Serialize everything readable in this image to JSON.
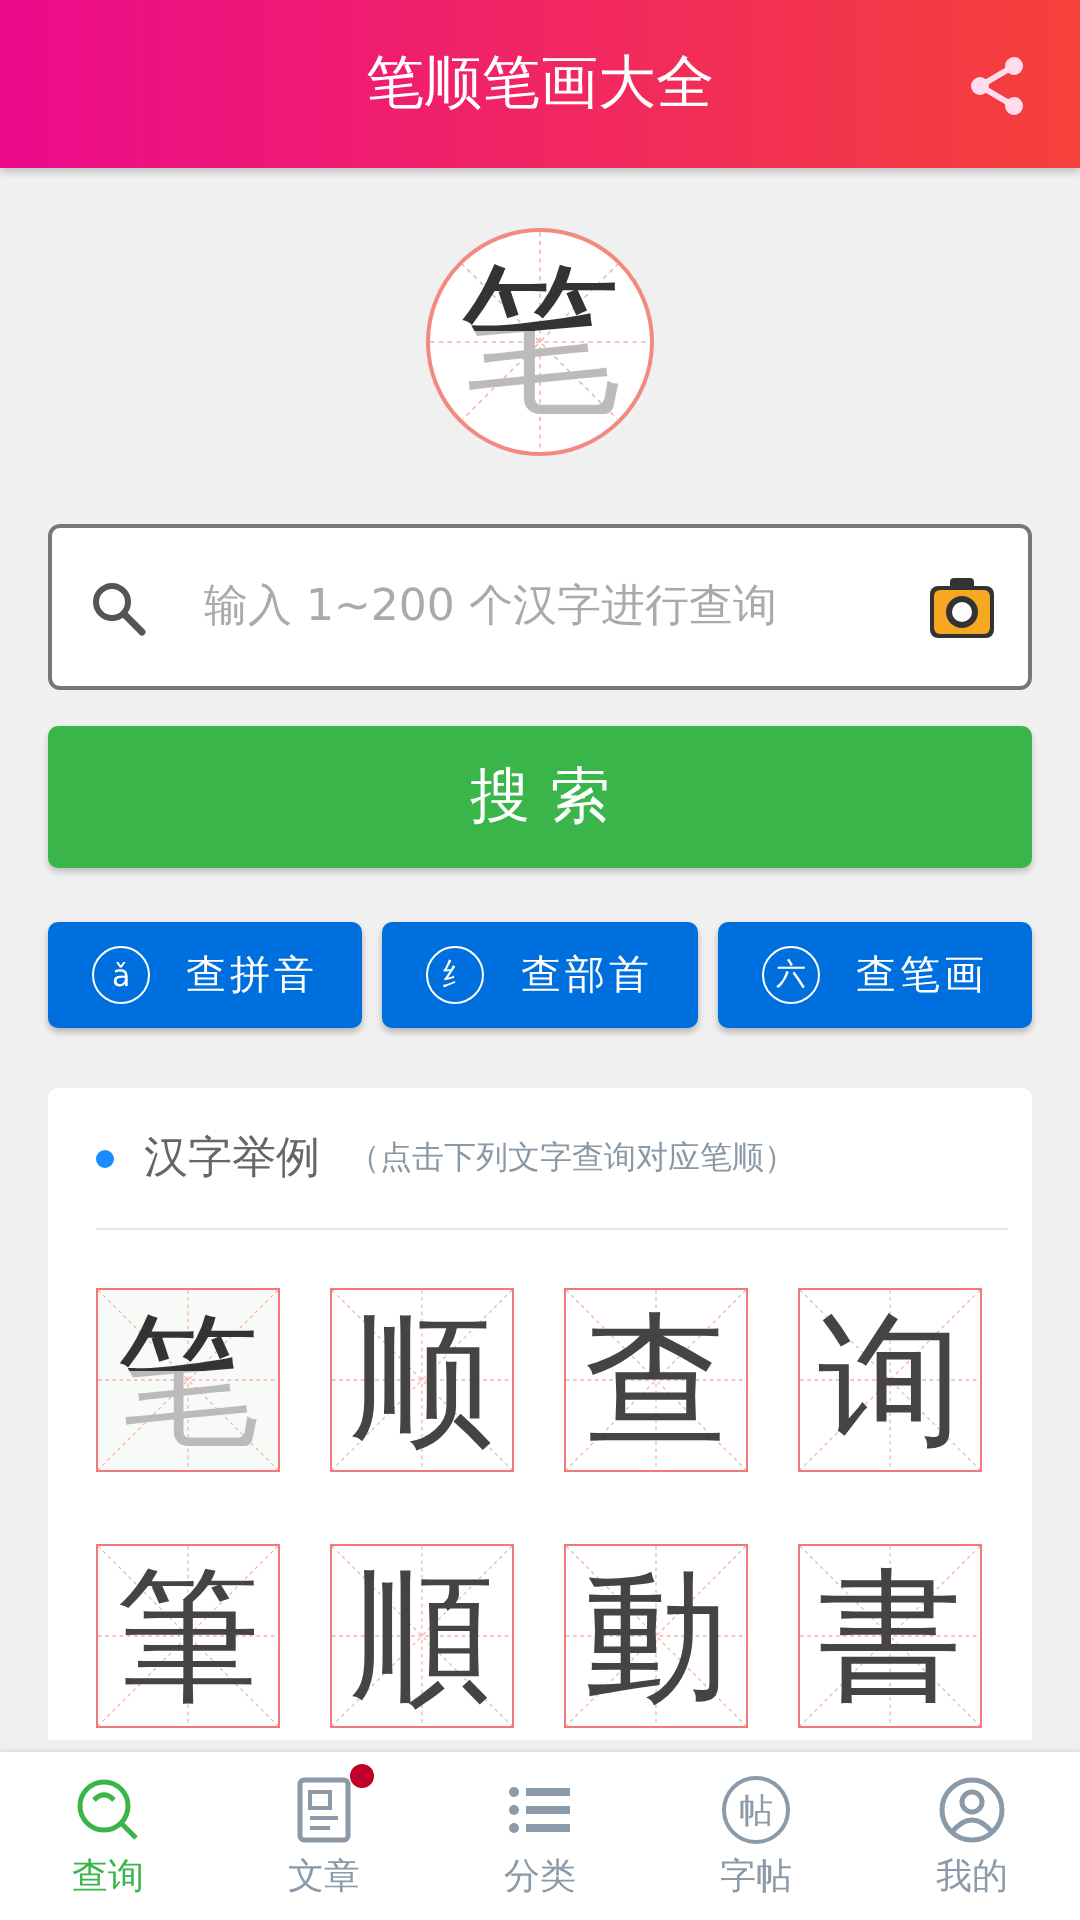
{
  "app_bar": {
    "title": "笔顺笔画大全"
  },
  "logo": {
    "character": "笔"
  },
  "search": {
    "placeholder": "输入 1~200 个汉字进行查询"
  },
  "search_button": {
    "label": "搜 索"
  },
  "lookup_buttons": [
    {
      "icon": "ǎ",
      "label": "查拼音"
    },
    {
      "icon": "纟",
      "label": "查部首"
    },
    {
      "icon": "六",
      "label": "查笔画"
    }
  ],
  "examples": {
    "title": "汉字举例",
    "hint": "（点击下列文字查询对应笔顺）",
    "characters": [
      {
        "character": "笔",
        "kind": "stroke_demo"
      },
      {
        "character": "顺",
        "kind": "plain"
      },
      {
        "character": "查",
        "kind": "plain"
      },
      {
        "character": "询",
        "kind": "plain"
      },
      {
        "character": "筆",
        "kind": "plain"
      },
      {
        "character": "順",
        "kind": "plain"
      },
      {
        "character": "動",
        "kind": "plain"
      },
      {
        "character": "書",
        "kind": "plain"
      }
    ]
  },
  "tab_bar": [
    {
      "label": "查询",
      "kind": "search",
      "selected": true,
      "badge": false
    },
    {
      "label": "文章",
      "kind": "document",
      "selected": false,
      "badge": true
    },
    {
      "label": "分类",
      "kind": "list",
      "selected": false,
      "badge": false
    },
    {
      "label": "字帖",
      "kind": "glyph",
      "glyph": "帖",
      "selected": false,
      "badge": false
    },
    {
      "label": "我的",
      "kind": "person",
      "selected": false,
      "badge": false
    }
  ]
}
